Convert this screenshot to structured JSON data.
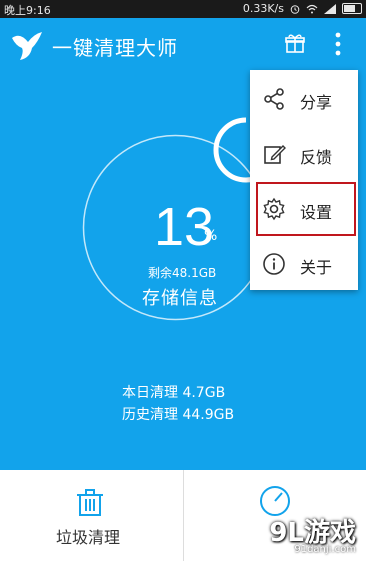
{
  "status_bar": {
    "time": "晚上9:16",
    "network_speed": "0.33K/s",
    "battery_icon": "battery-icon"
  },
  "app": {
    "title": "一键清理大师",
    "logo_icon": "bird-logo-icon",
    "gift_icon": "gift-icon",
    "more_icon": "more-vertical-icon",
    "primary_color": "#12a3eb"
  },
  "storage": {
    "percent": "13",
    "percent_unit": "%",
    "remaining": "剩余48.1GB",
    "label": "存储信息",
    "used_fraction": 0.13
  },
  "stats": {
    "today": "本日清理 4.7GB",
    "history": "历史清理 44.9GB"
  },
  "bottom": {
    "junk_label": "垃圾清理",
    "junk_icon": "trash-icon",
    "speed_icon": "speedometer-icon"
  },
  "menu": {
    "items": [
      {
        "label": "分享",
        "icon": "share-icon"
      },
      {
        "label": "反馈",
        "icon": "edit-icon"
      },
      {
        "label": "设置",
        "icon": "gear-icon"
      },
      {
        "label": "关于",
        "icon": "info-icon"
      }
    ],
    "highlight_color": "#c0161d"
  },
  "watermark": {
    "logo": "9L游戏",
    "url": "91danji.com"
  }
}
